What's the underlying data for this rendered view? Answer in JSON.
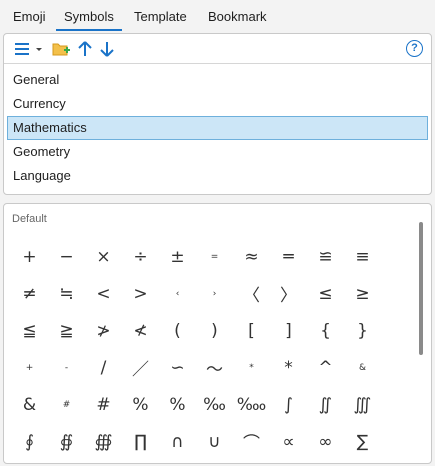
{
  "tabs": [
    {
      "label": "Emoji",
      "active": false
    },
    {
      "label": "Symbols",
      "active": true
    },
    {
      "label": "Template",
      "active": false
    },
    {
      "label": "Bookmark",
      "active": false
    }
  ],
  "toolbar": {
    "icons": [
      "list-icon",
      "dropdown-arrow-icon",
      "add-folder-icon",
      "move-up-icon",
      "move-down-icon"
    ],
    "help_label": "?"
  },
  "categories": [
    {
      "label": "General",
      "selected": false
    },
    {
      "label": "Currency",
      "selected": false
    },
    {
      "label": "Mathematics",
      "selected": true
    },
    {
      "label": "Geometry",
      "selected": false
    },
    {
      "label": "Language",
      "selected": false
    }
  ],
  "group_label": "Default",
  "symbols": [
    "+",
    "−",
    "×",
    "÷",
    "±",
    "=",
    "≈",
    "═",
    "≌",
    "≡",
    "≠",
    "≒",
    "<",
    ">",
    "‹",
    "›",
    "〈",
    "〉",
    "≤",
    "≥",
    "≦",
    "≧",
    "≯",
    "≮",
    "(",
    ")",
    "[",
    "]",
    "{",
    "}",
    "+",
    "-",
    "/",
    "／",
    "∽",
    "〜",
    "*",
    "*",
    "^",
    "&",
    "&",
    "#",
    "#",
    "%",
    "%",
    "‰",
    "‱",
    "∫",
    "∬",
    "∭",
    "∮",
    "∯",
    "∰",
    "∏",
    "∩",
    "∪",
    "⌒",
    "∝",
    "∞",
    "∑"
  ],
  "small_symbols": [
    5,
    14,
    15,
    30,
    31,
    36,
    39,
    41
  ],
  "colors": {
    "accent": "#1a73c8",
    "selected_bg": "#cce6f7",
    "selected_border": "#6eb0dc"
  }
}
